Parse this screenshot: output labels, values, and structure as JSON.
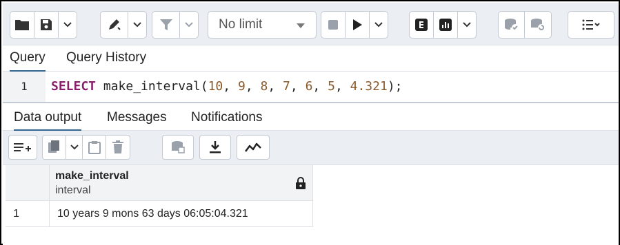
{
  "toolbar": {
    "limit_label": "No limit"
  },
  "query_tabs": {
    "query": "Query",
    "history": "Query History"
  },
  "editor": {
    "line_number": "1",
    "code_keyword": "SELECT",
    "code_func": " make_interval(",
    "args": [
      "10",
      "9",
      "8",
      "7",
      "6",
      "5",
      "4.321"
    ],
    "code_end": ");"
  },
  "result_tabs": {
    "data_output": "Data output",
    "messages": "Messages",
    "notifications": "Notifications"
  },
  "grid": {
    "columns": [
      {
        "name": "make_interval",
        "type": "interval"
      }
    ],
    "rows": [
      {
        "num": "1",
        "cells": [
          "10 years 9 mons 63 days 06:05:04.321"
        ]
      }
    ]
  },
  "colors": {
    "accent": "#326690",
    "keyword": "#8a1f6b",
    "number": "#8a5a2b",
    "icon": "#333333",
    "icon_disabled": "#9aa1ab"
  }
}
